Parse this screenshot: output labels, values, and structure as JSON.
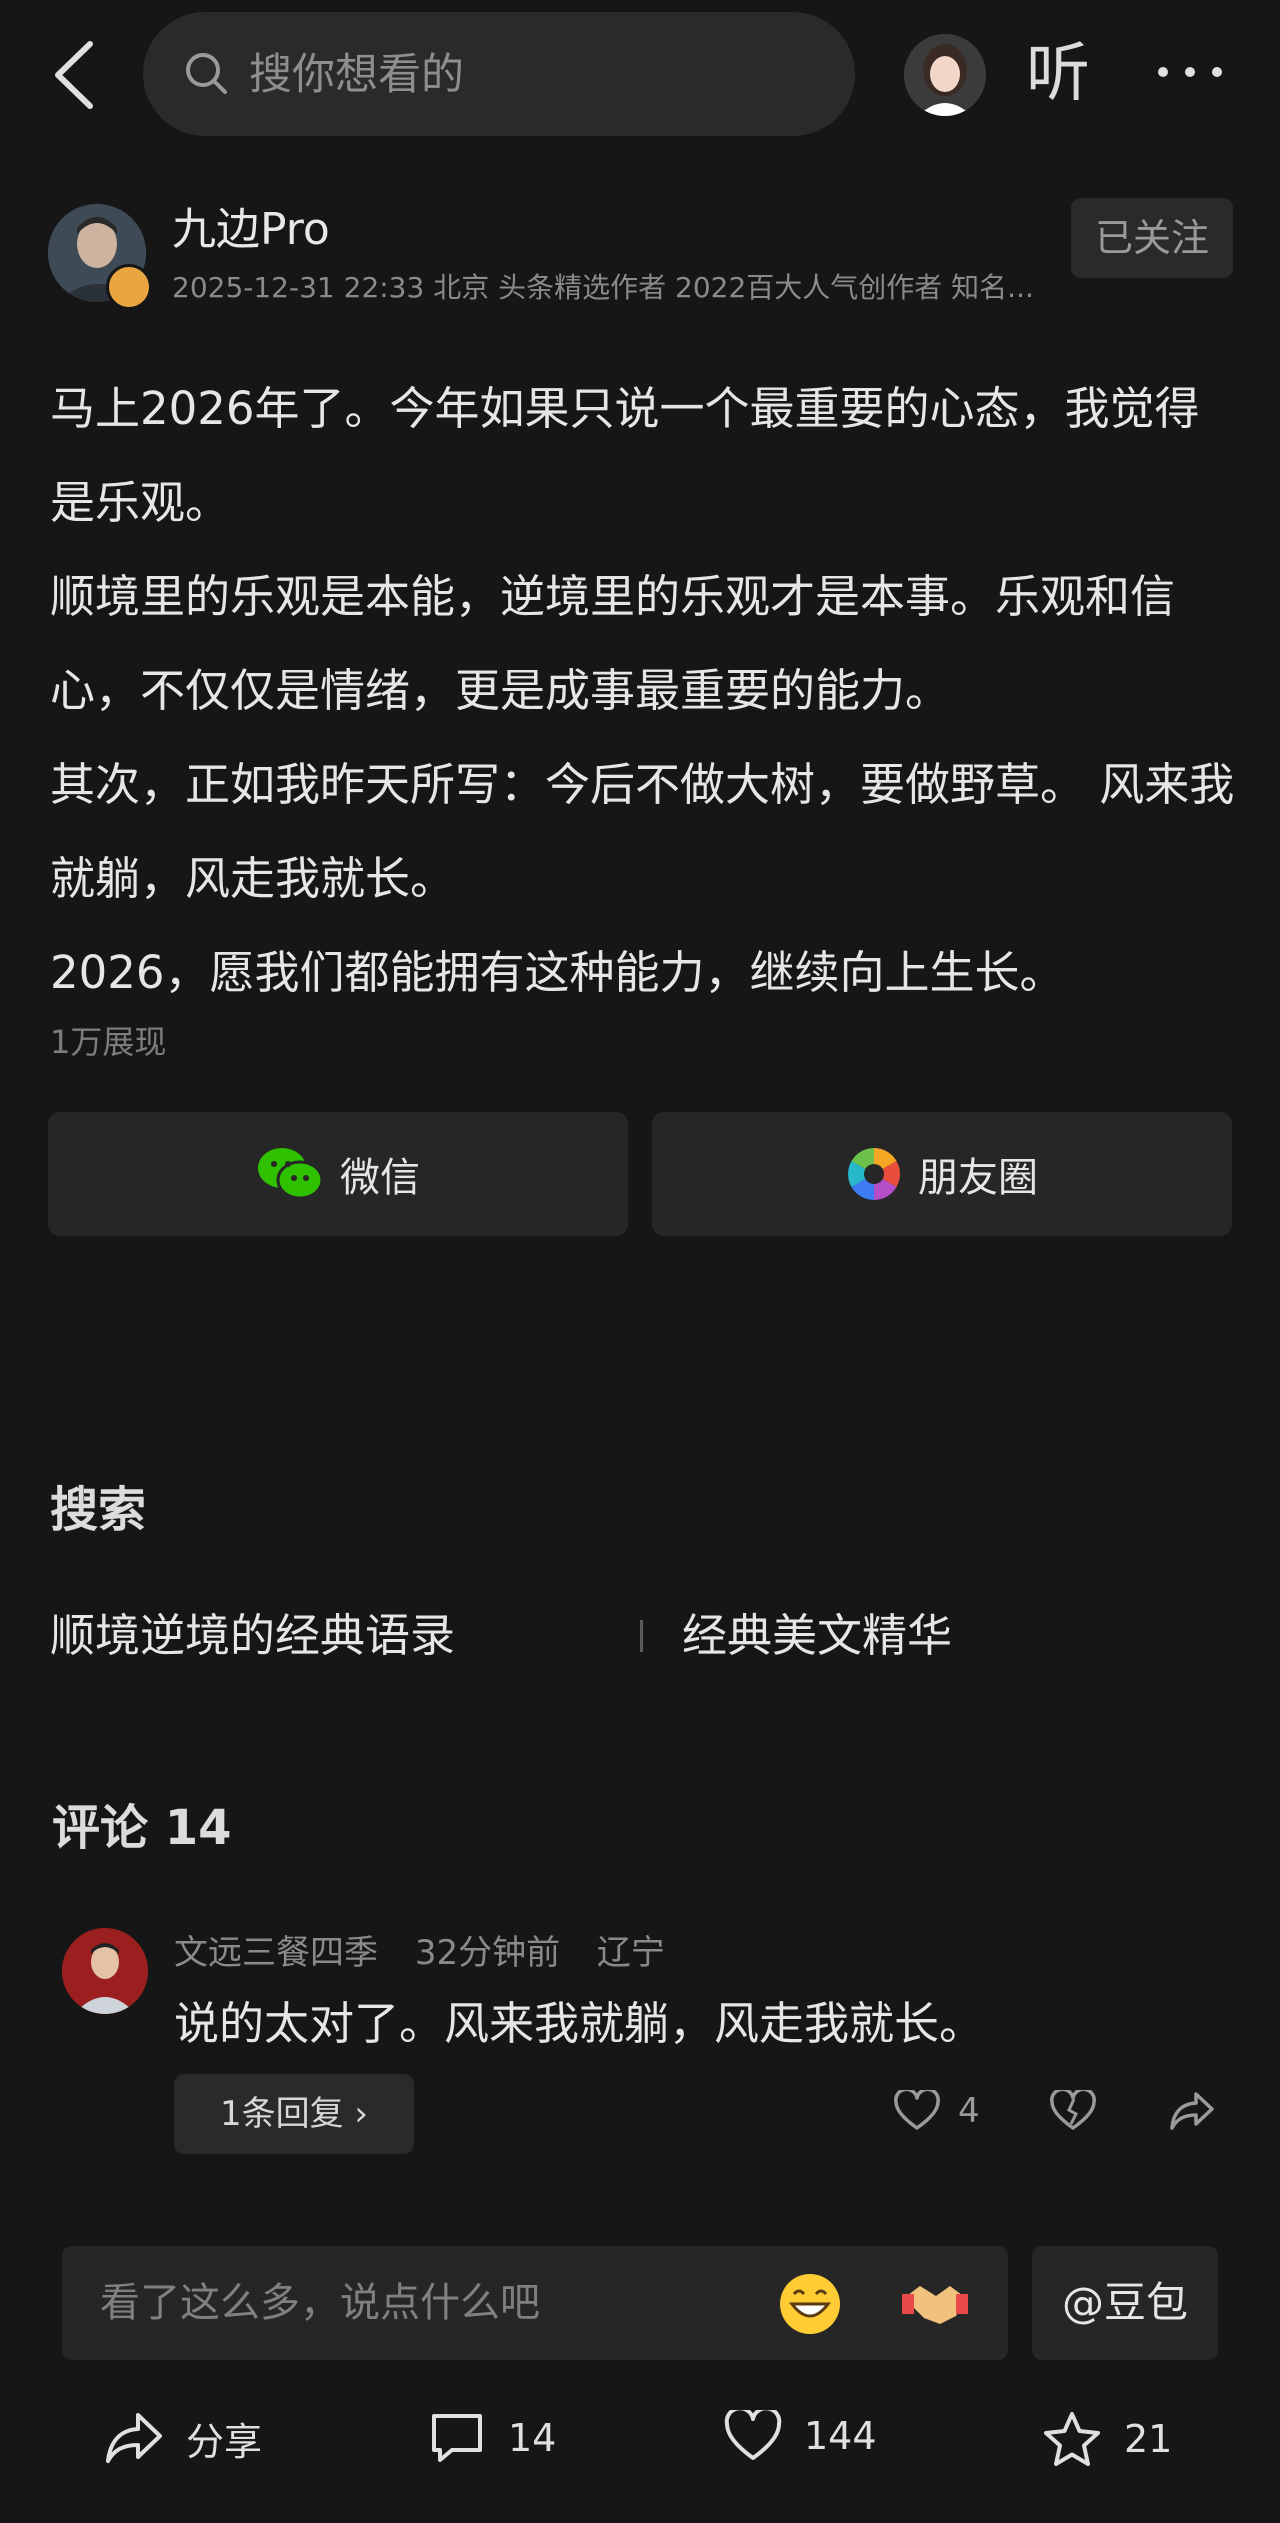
{
  "top_bar": {
    "search_placeholder": "搜你想看的",
    "listen_label": "听"
  },
  "author": {
    "name": "九边Pro",
    "meta": "2025-12-31 22:33 北京 头条精选作者 2022百大人气创作者 知名...",
    "follow_label": "已关注"
  },
  "post": {
    "paragraphs": [
      "马上2026年了。今年如果只说一个最重要的心态，我觉得是乐观。",
      "顺境里的乐观是本能，逆境里的乐观才是本事。乐观和信心，不仅仅是情绪，更是成事最重要的能力。",
      "其次，正如我昨天所写：今后不做大树，要做野草。 风来我就躺，风走我就长。",
      "2026，愿我们都能拥有这种能力，继续向上生长。"
    ],
    "views": "1万展现"
  },
  "share": {
    "wechat_label": "微信",
    "moments_label": "朋友圈"
  },
  "search_section": {
    "title": "搜索",
    "suggestions": [
      "顺境逆境的经典语录",
      "经典美文精华"
    ]
  },
  "comments": {
    "title": "评论 14",
    "items": [
      {
        "user": "文远三餐四季",
        "time": "32分钟前",
        "location": "辽宁",
        "text": "说的太对了。风来我就躺，风走我就长。",
        "reply_label": "1条回复 ›",
        "likes": "4"
      }
    ]
  },
  "input": {
    "placeholder": "看了这么多，说点什么吧",
    "doubao_label": "@豆包"
  },
  "toolbar": {
    "share_label": "分享",
    "comment_count": "14",
    "like_count": "144",
    "favorite_count": "21"
  },
  "icons": [
    "back-icon",
    "search-icon",
    "more-icon",
    "wechat-icon",
    "moments-icon",
    "heart-icon",
    "broken-heart-icon",
    "share-arrow-icon",
    "comment-icon",
    "star-icon"
  ]
}
